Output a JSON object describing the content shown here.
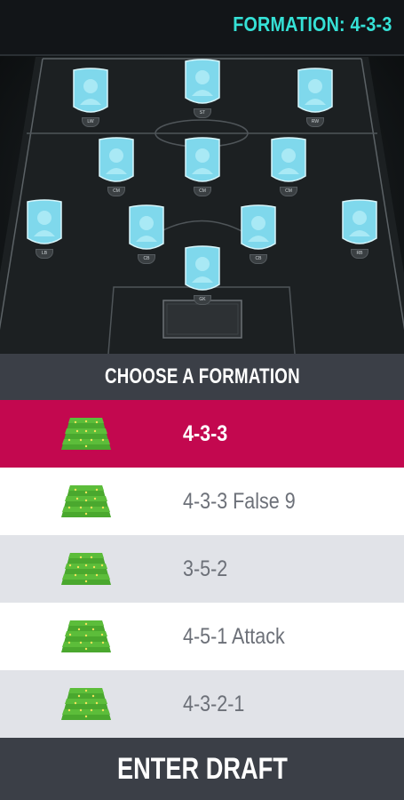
{
  "pitch": {
    "formation_title": "FORMATION: 4-3-3",
    "players": [
      {
        "position": "LW"
      },
      {
        "position": "ST"
      },
      {
        "position": "RW"
      },
      {
        "position": "CM"
      },
      {
        "position": "CM"
      },
      {
        "position": "CM"
      },
      {
        "position": "LB"
      },
      {
        "position": "CB"
      },
      {
        "position": "CB"
      },
      {
        "position": "RB"
      },
      {
        "position": "GK"
      }
    ]
  },
  "chooser": {
    "header": "CHOOSE A FORMATION",
    "formations": [
      {
        "label": "4-3-3",
        "selected": true
      },
      {
        "label": "4-3-3 False 9",
        "selected": false
      },
      {
        "label": "3-5-2",
        "selected": false
      },
      {
        "label": "4-5-1 Attack",
        "selected": false
      },
      {
        "label": "4-3-2-1",
        "selected": false
      }
    ]
  },
  "footer": {
    "enter_draft_label": "ENTER DRAFT"
  },
  "colors": {
    "accent_teal": "#35e1d6",
    "selected_row": "#c3084f",
    "header_bar": "#3b3f47",
    "card_fill": "#7fd8ec"
  }
}
